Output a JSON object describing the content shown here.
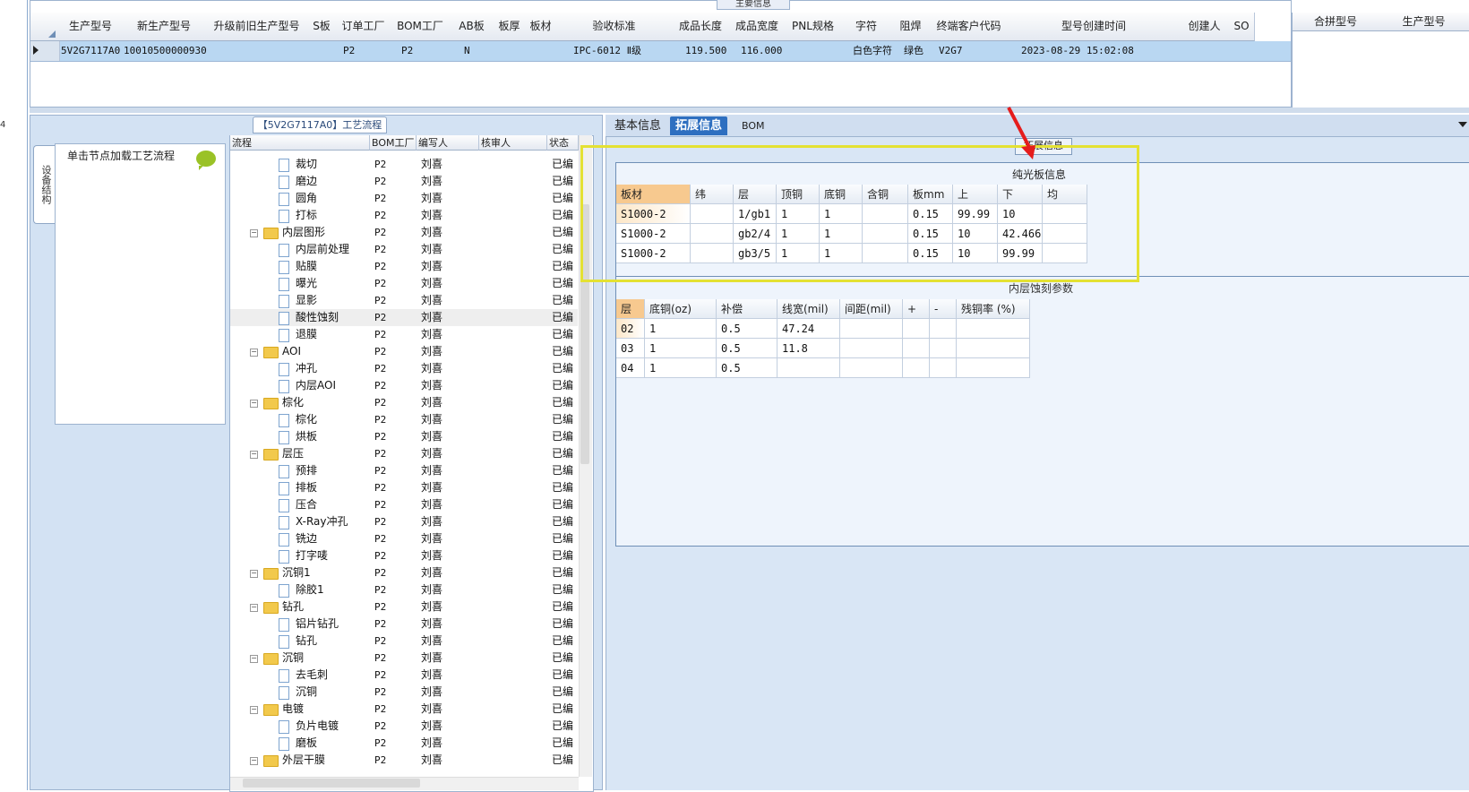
{
  "main_info_tab": "主要信息",
  "top_grid": {
    "headers": [
      "生产型号",
      "新生产型号",
      "升级前旧生产型号",
      "S板",
      "订单工厂",
      "BOM工厂",
      "AB板",
      "板厚",
      "板材",
      "验收标准",
      "成品长度",
      "成品宽度",
      "PNL规格",
      "字符",
      "阻焊",
      "终端客户代码",
      "型号创建时间",
      "创建人",
      "SO"
    ],
    "row": {
      "生产型号": "5V2G7117A0",
      "新生产型号": "10010500000930",
      "订单工厂": "P2",
      "BOM工厂": "P2",
      "AB板": "N",
      "验收标准": "IPC-6012 Ⅱ级",
      "成品长度": "119.500",
      "成品宽度": "116.000",
      "字符": "白色字符",
      "阻焊": "绿色",
      "终端客户代码": "V2G7",
      "型号创建时间": "2023-08-29 15:02:08"
    },
    "row_values": [
      "5V2G7117A0",
      "10010500000930",
      "P2",
      "P2",
      "N",
      "IPC-6012 Ⅱ级",
      "119.500",
      "116.000",
      "白色字符",
      "绿色",
      "V2G7",
      "2023-08-29 15:02:08"
    ]
  },
  "right_grid": {
    "headers": [
      "合拼型号",
      "生产型号"
    ]
  },
  "process_panel": {
    "title": "【5V2G7117A0】工艺流程",
    "vertical_tab": "设备结构",
    "hint": "单击节点加载工艺流程",
    "columns": [
      "流程",
      "BOM工厂",
      "编写人",
      "核审人",
      "状态"
    ],
    "rows": [
      {
        "name": "裁切",
        "type": "file",
        "bom": "P2",
        "writer": "刘喜",
        "status": "已编"
      },
      {
        "name": "磨边",
        "type": "file",
        "bom": "P2",
        "writer": "刘喜",
        "status": "已编"
      },
      {
        "name": "圆角",
        "type": "file",
        "bom": "P2",
        "writer": "刘喜",
        "status": "已编"
      },
      {
        "name": "打标",
        "type": "file",
        "bom": "P2",
        "writer": "刘喜",
        "status": "已编"
      },
      {
        "name": "内层图形",
        "type": "folder",
        "bom": "P2",
        "writer": "刘喜",
        "status": "已编"
      },
      {
        "name": "内层前处理",
        "type": "file",
        "bom": "P2",
        "writer": "刘喜",
        "status": "已编"
      },
      {
        "name": "贴膜",
        "type": "file",
        "bom": "P2",
        "writer": "刘喜",
        "status": "已编"
      },
      {
        "name": "曝光",
        "type": "file",
        "bom": "P2",
        "writer": "刘喜",
        "status": "已编"
      },
      {
        "name": "显影",
        "type": "file",
        "bom": "P2",
        "writer": "刘喜",
        "status": "已编"
      },
      {
        "name": "酸性蚀刻",
        "type": "file",
        "bom": "P2",
        "writer": "刘喜",
        "status": "已编"
      },
      {
        "name": "退膜",
        "type": "file",
        "bom": "P2",
        "writer": "刘喜",
        "status": "已编"
      },
      {
        "name": "AOI",
        "type": "folder",
        "bom": "P2",
        "writer": "刘喜",
        "status": "已编"
      },
      {
        "name": "冲孔",
        "type": "file",
        "bom": "P2",
        "writer": "刘喜",
        "status": "已编"
      },
      {
        "name": "内层AOI",
        "type": "file",
        "bom": "P2",
        "writer": "刘喜",
        "status": "已编"
      },
      {
        "name": "棕化",
        "type": "folder",
        "bom": "P2",
        "writer": "刘喜",
        "status": "已编"
      },
      {
        "name": "棕化",
        "type": "file",
        "bom": "P2",
        "writer": "刘喜",
        "status": "已编"
      },
      {
        "name": "烘板",
        "type": "file",
        "bom": "P2",
        "writer": "刘喜",
        "status": "已编"
      },
      {
        "name": "层压",
        "type": "folder",
        "bom": "P2",
        "writer": "刘喜",
        "status": "已编"
      },
      {
        "name": "预排",
        "type": "file",
        "bom": "P2",
        "writer": "刘喜",
        "status": "已编"
      },
      {
        "name": "排板",
        "type": "file",
        "bom": "P2",
        "writer": "刘喜",
        "status": "已编"
      },
      {
        "name": "压合",
        "type": "file",
        "bom": "P2",
        "writer": "刘喜",
        "status": "已编"
      },
      {
        "name": "X-Ray冲孔",
        "type": "file",
        "bom": "P2",
        "writer": "刘喜",
        "status": "已编"
      },
      {
        "name": "铣边",
        "type": "file",
        "bom": "P2",
        "writer": "刘喜",
        "status": "已编"
      },
      {
        "name": "打字唛",
        "type": "file",
        "bom": "P2",
        "writer": "刘喜",
        "status": "已编"
      },
      {
        "name": "沉铜1",
        "type": "folder",
        "bom": "P2",
        "writer": "刘喜",
        "status": "已编"
      },
      {
        "name": "除胶1",
        "type": "file",
        "bom": "P2",
        "writer": "刘喜",
        "status": "已编"
      },
      {
        "name": "钻孔",
        "type": "folder",
        "bom": "P2",
        "writer": "刘喜",
        "status": "已编"
      },
      {
        "name": "铝片钻孔",
        "type": "file",
        "bom": "P2",
        "writer": "刘喜",
        "status": "已编"
      },
      {
        "name": "钻孔",
        "type": "file",
        "bom": "P2",
        "writer": "刘喜",
        "status": "已编"
      },
      {
        "name": "沉铜",
        "type": "folder",
        "bom": "P2",
        "writer": "刘喜",
        "status": "已编"
      },
      {
        "name": "去毛刺",
        "type": "file",
        "bom": "P2",
        "writer": "刘喜",
        "status": "已编"
      },
      {
        "name": "沉铜",
        "type": "file",
        "bom": "P2",
        "writer": "刘喜",
        "status": "已编"
      },
      {
        "name": "电镀",
        "type": "folder",
        "bom": "P2",
        "writer": "刘喜",
        "status": "已编"
      },
      {
        "name": "负片电镀",
        "type": "file",
        "bom": "P2",
        "writer": "刘喜",
        "status": "已编"
      },
      {
        "name": "磨板",
        "type": "file",
        "bom": "P2",
        "writer": "刘喜",
        "status": "已编"
      },
      {
        "name": "外层干膜",
        "type": "folder",
        "bom": "P2",
        "writer": "刘喜",
        "status": "已编"
      }
    ]
  },
  "right_tabs": [
    "基本信息",
    "拓展信息",
    "BOM"
  ],
  "ext_button": "拓展信息",
  "sec1": {
    "title": "纯光板信息",
    "headers": [
      "板材",
      "纬",
      "层",
      "顶铜",
      "底铜",
      "含铜",
      "板mm",
      "上",
      "下",
      "均"
    ],
    "rows": [
      [
        "S1000-2",
        "",
        "1/gb1",
        "1",
        "1",
        "",
        "0.15",
        "99.99",
        "10",
        ""
      ],
      [
        "S1000-2",
        "",
        "gb2/4",
        "1",
        "1",
        "",
        "0.15",
        "10",
        "42.466",
        ""
      ],
      [
        "S1000-2",
        "",
        "gb3/5",
        "1",
        "1",
        "",
        "0.15",
        "10",
        "99.99",
        ""
      ]
    ]
  },
  "sec2": {
    "title": "内层蚀刻参数",
    "headers": [
      "层",
      "底铜(oz)",
      "补偿",
      "线宽(mil)",
      "间距(mil)",
      "+",
      "-",
      "残铜率 (%)"
    ],
    "rows": [
      [
        "02",
        "1",
        "0.5",
        "47.24",
        "",
        "",
        "",
        ""
      ],
      [
        "03",
        "1",
        "0.5",
        "11.8",
        "",
        "",
        "",
        ""
      ],
      [
        "04",
        "1",
        "0.5",
        "",
        "",
        "",
        "",
        ""
      ]
    ]
  },
  "colors": {
    "accent": "#2e6fc0",
    "highlight_box": "#e4e133",
    "arrow": "#e51c1c",
    "row_select": "#b9d7f2"
  }
}
